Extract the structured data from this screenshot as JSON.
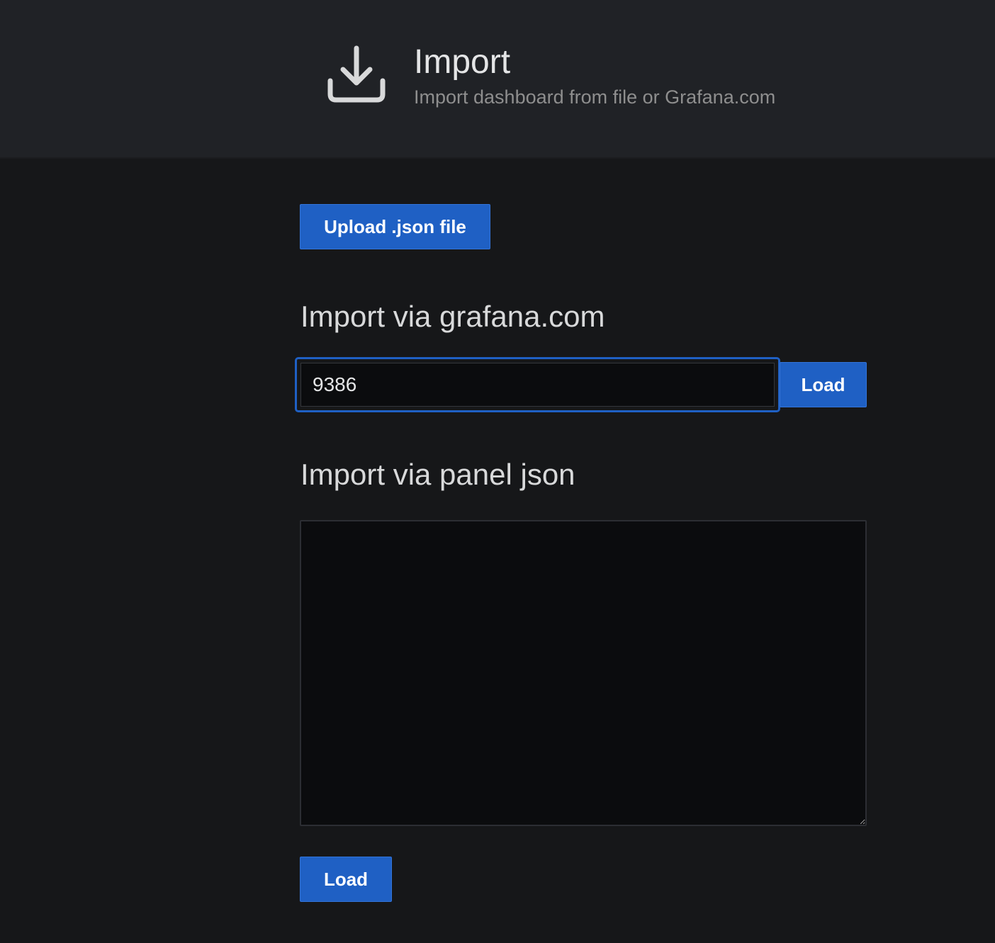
{
  "header": {
    "icon": "download-icon",
    "title": "Import",
    "subtitle": "Import dashboard from file or Grafana.com"
  },
  "upload": {
    "button_label": "Upload .json file"
  },
  "grafana_com": {
    "title": "Import via grafana.com",
    "input_value": "9386",
    "load_label": "Load"
  },
  "panel_json": {
    "title": "Import via panel json",
    "textarea_value": "",
    "load_label": "Load"
  },
  "colors": {
    "background": "#161719",
    "header_background": "#202226",
    "primary_button": "#1f60c4",
    "focus_border": "#1f60c4",
    "input_background": "#0b0c0e"
  }
}
